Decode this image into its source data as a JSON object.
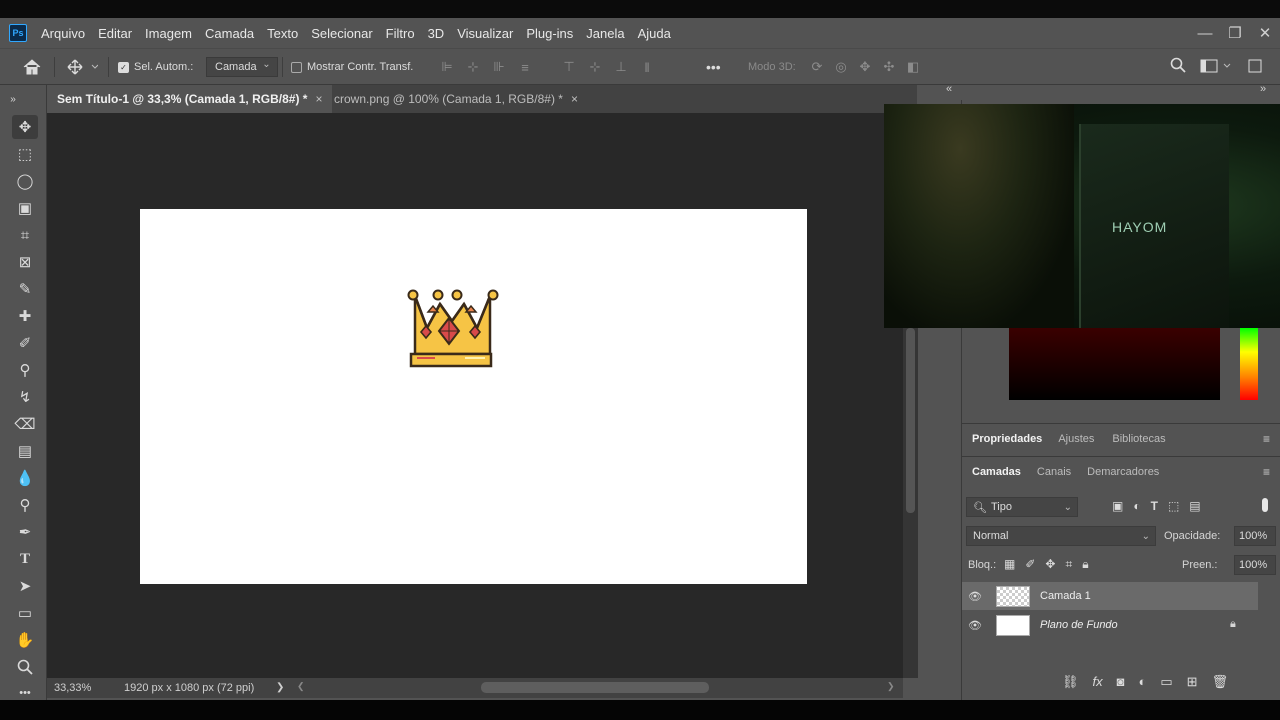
{
  "app": {
    "logo": "Ps"
  },
  "menubar": {
    "items": [
      "Arquivo",
      "Editar",
      "Imagem",
      "Camada",
      "Texto",
      "Selecionar",
      "Filtro",
      "3D",
      "Visualizar",
      "Plug-ins",
      "Janela",
      "Ajuda"
    ]
  },
  "window_controls": {
    "minimize": "—",
    "restore": "❐",
    "close": "✕"
  },
  "options": {
    "auto_select_label": "Sel. Autom.:",
    "auto_select_target": "Camada",
    "show_transform_label": "Mostrar Contr. Transf.",
    "mode3d_label": "Modo 3D:",
    "more": "•••"
  },
  "tabs": [
    {
      "label": "Sem Título-1 @ 33,3% (Camada 1, RGB/8#) *",
      "close": "×"
    },
    {
      "label": "crown.png @ 100% (Camada 1, RGB/8#) *",
      "close": "×"
    }
  ],
  "status": {
    "zoom": "33,33%",
    "doc_info": "1920 px x 1080 px (72 ppi)",
    "arrow": "❯",
    "left_arrow": "❮",
    "right_arrow": "❯"
  },
  "panels": {
    "collapse_left": "»",
    "collapse_mid": "«",
    "collapse_right": "»",
    "props_tabs": [
      "Propriedades",
      "Ajustes",
      "Bibliotecas"
    ],
    "layers_tabs": [
      "Camadas",
      "Canais",
      "Demarcadores"
    ],
    "panel_menu": "≡"
  },
  "layers": {
    "filter_kind": "Tipo",
    "blend_mode": "Normal",
    "opacity_label": "Opacidade:",
    "opacity_value": "100%",
    "lock_label": "Bloq.:",
    "fill_label": "Preen.:",
    "fill_value": "100%",
    "items": [
      {
        "name": "Camada 1",
        "selected": true
      },
      {
        "name": "Plano de Fundo",
        "selected": false
      }
    ]
  },
  "webcam": {
    "brand_text": "HAYOM"
  },
  "colors": {
    "accent": "#31a8ff",
    "crown_gold": "#f6c445",
    "crown_red": "#d94a4a",
    "crown_outline": "#3a2a1a"
  }
}
